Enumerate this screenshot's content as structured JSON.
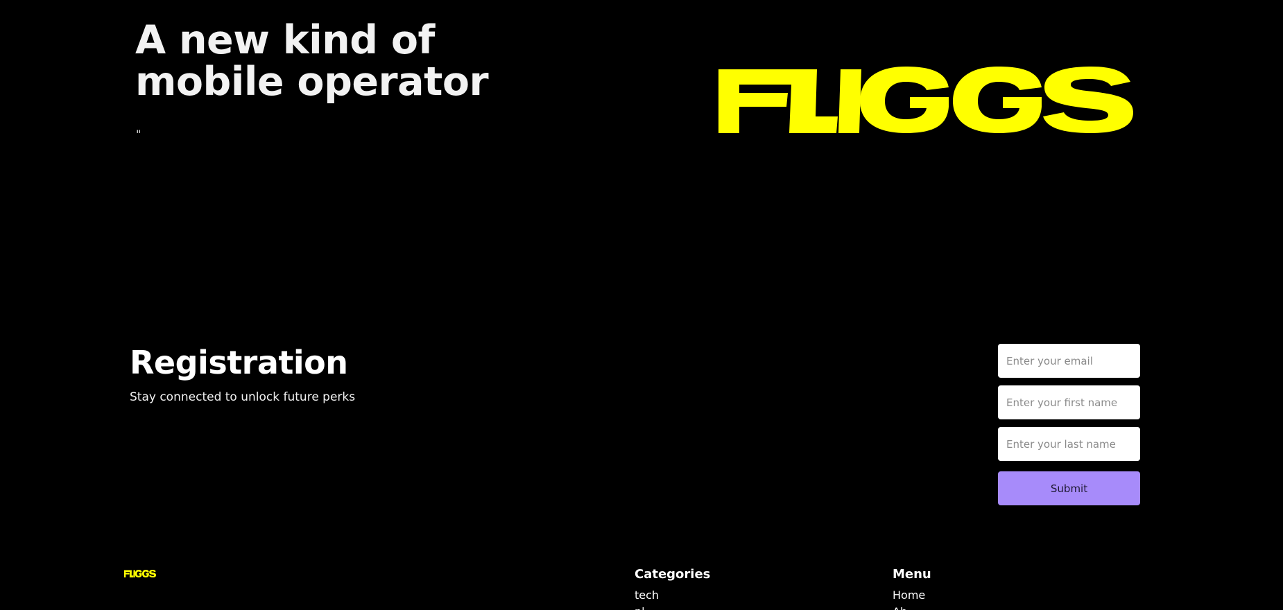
{
  "hero": {
    "title": "A new kind of mobile operator",
    "quote": "\"",
    "logo_text": "FLIGGS"
  },
  "registration": {
    "title": "Registration",
    "subtitle": "Stay connected to unlock future perks",
    "email_placeholder": "Enter your email",
    "first_name_placeholder": "Enter your first name",
    "last_name_placeholder": "Enter your last name",
    "submit_label": "Submit"
  },
  "footer": {
    "logo_text": "FLIGGS",
    "categories": {
      "title": "Categories",
      "items": [
        "tech",
        "pl"
      ]
    },
    "menu": {
      "title": "Menu",
      "items": [
        "Home",
        "Ab"
      ]
    }
  },
  "colors": {
    "background": "#000000",
    "brand_yellow": "#ffff00",
    "accent_purple": "#a78bfa"
  }
}
